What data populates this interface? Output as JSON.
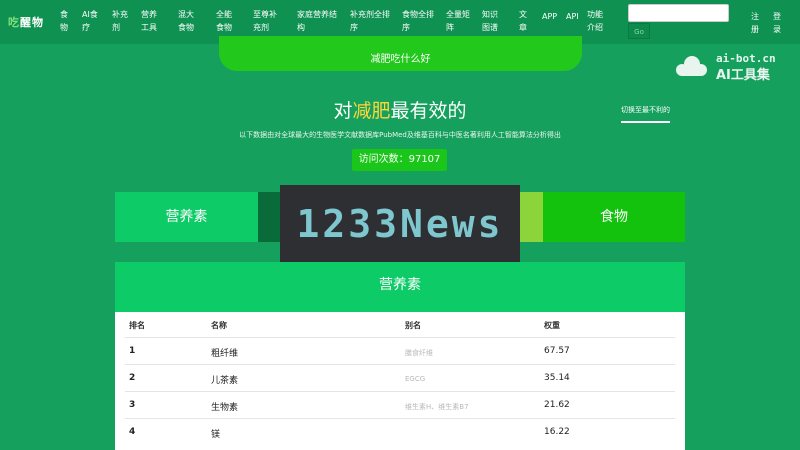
{
  "nav": {
    "logo_green": "吃",
    "logo_white": "醒",
    "logo_tail": "物",
    "items": [
      "食物",
      "AI食疗",
      "补充剂",
      "营养工具",
      "混大食物",
      "全能食物",
      "至尊补充剂",
      "家庭营养结构",
      "补充剂全排序",
      "食物全排序",
      "全量矩阵",
      "知识图谱",
      "文章",
      "APP",
      "API",
      "功能介绍"
    ],
    "go": "Go",
    "register": "注册",
    "login": "登录"
  },
  "hero": {
    "pill_text": "减肥吃什么好",
    "headline_pre": "对",
    "headline_hl": "减肥",
    "headline_post": "最有效的",
    "switch": "切换至最不利的",
    "subtext": "以下数据由对全球最大的生物医学文献数据库PubMed及维基百科与中医名著利用人工智能算法分析得出",
    "visits": "访问次数：97107"
  },
  "watermark": {
    "line1": "ai-bot.cn",
    "line2": "AI工具集"
  },
  "ad": {
    "text": "1233News"
  },
  "tabs": {
    "nutrient": "营养素",
    "food": "食物"
  },
  "table": {
    "title": "营养素",
    "headers": {
      "rank": "排名",
      "name": "名称",
      "alias": "别名",
      "weight": "权重"
    },
    "rows": [
      {
        "rank": "1",
        "name": "粗纤维",
        "alias": "膳食纤维",
        "weight": "67.57"
      },
      {
        "rank": "2",
        "name": "儿茶素",
        "alias": "EGCG",
        "weight": "35.14"
      },
      {
        "rank": "3",
        "name": "生物素",
        "alias": "维生素H、维生素B7",
        "weight": "21.62"
      },
      {
        "rank": "4",
        "name": "镁",
        "alias": "",
        "weight": "16.22"
      }
    ]
  }
}
